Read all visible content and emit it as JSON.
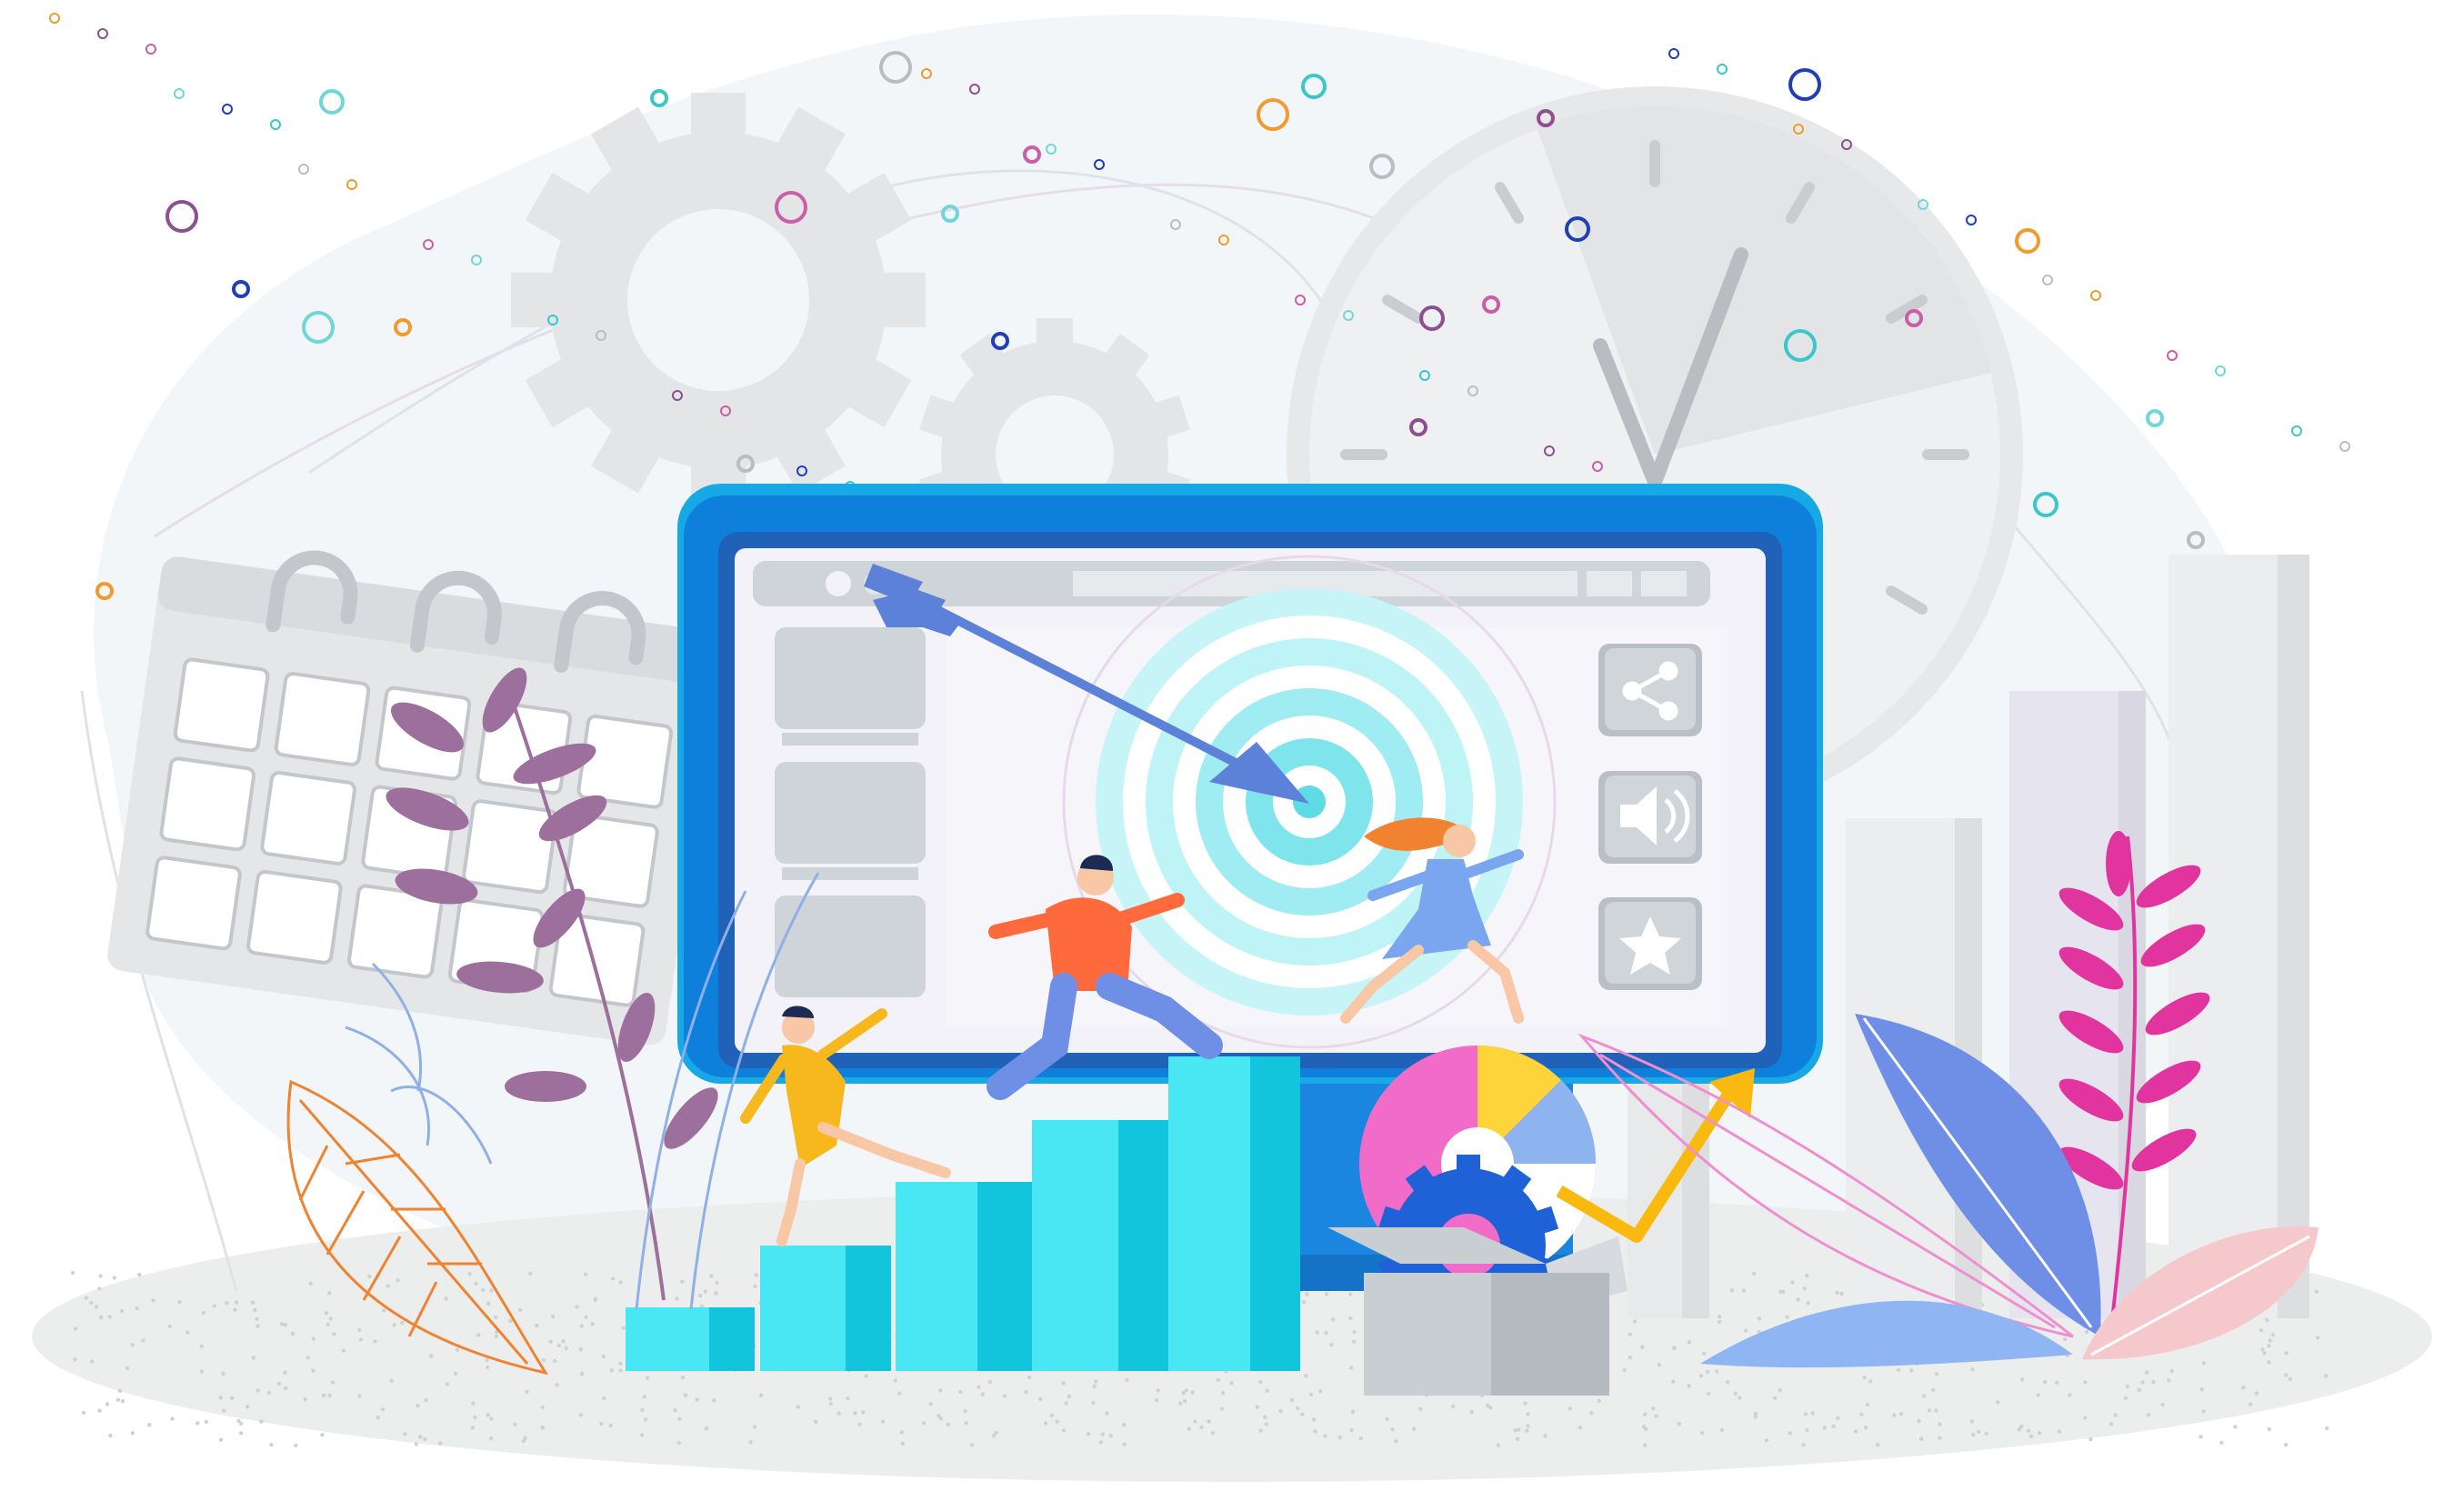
{
  "scene": {
    "kind": "flat vector illustration",
    "palette": {
      "monitor_frame": "#0f7fdc",
      "monitor_bezel": "#1f62b8",
      "screen_bg": "#f3f2f8",
      "ui_gray": "#cfd4d8",
      "target_light": "#bff4f6",
      "target_mid": "#7fe4ec",
      "arrow": "#5b82d8",
      "steps": "#3fe3f0",
      "gear": "#e3e5e7",
      "clock_face": "#eceded",
      "calendar": "#e8e9ea",
      "plant_purple": "#9d6f9d",
      "plant_magenta": "#e2349e",
      "leaf_blue": "#6f8fe6",
      "leaf_pink": "#f5c8cc",
      "growth_arrow": "#f9b90f",
      "person_orange": "#ff6a3d",
      "person_blue": "#7aa6f0",
      "person_yellow": "#f6b81c"
    },
    "icons": [
      "share-icon",
      "speaker-icon",
      "star-icon",
      "gear-icon",
      "clock-icon",
      "calendar-icon",
      "target-icon",
      "arrow-icon",
      "growth-arrow-icon",
      "pie-chart-icon",
      "box-icon"
    ]
  }
}
